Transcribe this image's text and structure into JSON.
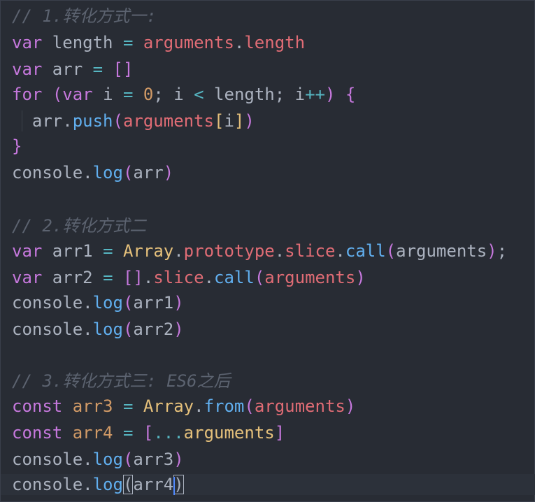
{
  "editor": {
    "language": "javascript",
    "theme_background": "#282c34",
    "lines": [
      [
        {
          "t": "// 1.转化方式一:",
          "k": "comment"
        }
      ],
      [
        {
          "t": "var",
          "k": "keyword"
        },
        {
          "t": " length ",
          "k": "var"
        },
        {
          "t": "=",
          "k": "op"
        },
        {
          "t": " ",
          "k": "var"
        },
        {
          "t": "arguments",
          "k": "prop"
        },
        {
          "t": ".",
          "k": "punct"
        },
        {
          "t": "length",
          "k": "prop"
        }
      ],
      [
        {
          "t": "var",
          "k": "keyword"
        },
        {
          "t": " arr ",
          "k": "var"
        },
        {
          "t": "=",
          "k": "op"
        },
        {
          "t": " ",
          "k": "var"
        },
        {
          "t": "[]",
          "k": "bracket"
        }
      ],
      [
        {
          "t": "for",
          "k": "keyword"
        },
        {
          "t": " ",
          "k": "var"
        },
        {
          "t": "(",
          "k": "bracket"
        },
        {
          "t": "var",
          "k": "keyword"
        },
        {
          "t": " i ",
          "k": "var"
        },
        {
          "t": "=",
          "k": "op"
        },
        {
          "t": " ",
          "k": "var"
        },
        {
          "t": "0",
          "k": "number"
        },
        {
          "t": "; i ",
          "k": "var"
        },
        {
          "t": "<",
          "k": "op"
        },
        {
          "t": " length; i",
          "k": "var"
        },
        {
          "t": "++",
          "k": "op"
        },
        {
          "t": ")",
          "k": "bracket"
        },
        {
          "t": " ",
          "k": "var"
        },
        {
          "t": "{",
          "k": "bracket"
        }
      ],
      [
        {
          "t": "  arr",
          "k": "var"
        },
        {
          "t": ".",
          "k": "punct"
        },
        {
          "t": "push",
          "k": "func"
        },
        {
          "t": "(",
          "k": "bracket"
        },
        {
          "t": "arguments",
          "k": "prop"
        },
        {
          "t": "[",
          "k": "class"
        },
        {
          "t": "i",
          "k": "var"
        },
        {
          "t": "]",
          "k": "class"
        },
        {
          "t": ")",
          "k": "bracket"
        }
      ],
      [
        {
          "t": "}",
          "k": "bracket"
        }
      ],
      [
        {
          "t": "console",
          "k": "var"
        },
        {
          "t": ".",
          "k": "punct"
        },
        {
          "t": "log",
          "k": "func"
        },
        {
          "t": "(",
          "k": "bracket"
        },
        {
          "t": "arr",
          "k": "var"
        },
        {
          "t": ")",
          "k": "bracket"
        }
      ],
      [],
      [
        {
          "t": "// 2.转化方式二",
          "k": "comment"
        }
      ],
      [
        {
          "t": "var",
          "k": "keyword"
        },
        {
          "t": " arr1 ",
          "k": "var"
        },
        {
          "t": "=",
          "k": "op"
        },
        {
          "t": " ",
          "k": "var"
        },
        {
          "t": "Array",
          "k": "class"
        },
        {
          "t": ".",
          "k": "punct"
        },
        {
          "t": "prototype",
          "k": "prop"
        },
        {
          "t": ".",
          "k": "punct"
        },
        {
          "t": "slice",
          "k": "prop"
        },
        {
          "t": ".",
          "k": "punct"
        },
        {
          "t": "call",
          "k": "func"
        },
        {
          "t": "(",
          "k": "bracket"
        },
        {
          "t": "arguments",
          "k": "var"
        },
        {
          "t": ")",
          "k": "bracket"
        },
        {
          "t": ";",
          "k": "punct"
        }
      ],
      [
        {
          "t": "var",
          "k": "keyword"
        },
        {
          "t": " arr2 ",
          "k": "var"
        },
        {
          "t": "=",
          "k": "op"
        },
        {
          "t": " ",
          "k": "var"
        },
        {
          "t": "[]",
          "k": "bracket"
        },
        {
          "t": ".",
          "k": "punct"
        },
        {
          "t": "slice",
          "k": "prop"
        },
        {
          "t": ".",
          "k": "punct"
        },
        {
          "t": "call",
          "k": "func"
        },
        {
          "t": "(",
          "k": "bracket"
        },
        {
          "t": "arguments",
          "k": "prop"
        },
        {
          "t": ")",
          "k": "bracket"
        }
      ],
      [
        {
          "t": "console",
          "k": "var"
        },
        {
          "t": ".",
          "k": "punct"
        },
        {
          "t": "log",
          "k": "func"
        },
        {
          "t": "(",
          "k": "bracket"
        },
        {
          "t": "arr1",
          "k": "var"
        },
        {
          "t": ")",
          "k": "bracket"
        }
      ],
      [
        {
          "t": "console",
          "k": "var"
        },
        {
          "t": ".",
          "k": "punct"
        },
        {
          "t": "log",
          "k": "func"
        },
        {
          "t": "(",
          "k": "bracket"
        },
        {
          "t": "arr2",
          "k": "var"
        },
        {
          "t": ")",
          "k": "bracket"
        }
      ],
      [],
      [
        {
          "t": "// 3.转化方式三: ES6之后",
          "k": "comment"
        }
      ],
      [
        {
          "t": "const",
          "k": "keyword"
        },
        {
          "t": " ",
          "k": "var"
        },
        {
          "t": "arr3",
          "k": "const"
        },
        {
          "t": " ",
          "k": "var"
        },
        {
          "t": "=",
          "k": "op"
        },
        {
          "t": " ",
          "k": "var"
        },
        {
          "t": "Array",
          "k": "class"
        },
        {
          "t": ".",
          "k": "punct"
        },
        {
          "t": "from",
          "k": "func"
        },
        {
          "t": "(",
          "k": "bracket"
        },
        {
          "t": "arguments",
          "k": "prop"
        },
        {
          "t": ")",
          "k": "bracket"
        }
      ],
      [
        {
          "t": "const",
          "k": "keyword"
        },
        {
          "t": " ",
          "k": "var"
        },
        {
          "t": "arr4",
          "k": "const"
        },
        {
          "t": " ",
          "k": "var"
        },
        {
          "t": "=",
          "k": "op"
        },
        {
          "t": " ",
          "k": "var"
        },
        {
          "t": "[",
          "k": "bracket"
        },
        {
          "t": "...",
          "k": "op"
        },
        {
          "t": "arguments",
          "k": "class"
        },
        {
          "t": "]",
          "k": "bracket"
        }
      ],
      [
        {
          "t": "console",
          "k": "var"
        },
        {
          "t": ".",
          "k": "punct"
        },
        {
          "t": "log",
          "k": "func"
        },
        {
          "t": "(",
          "k": "bracket"
        },
        {
          "t": "arr3",
          "k": "var"
        },
        {
          "t": ")",
          "k": "bracket"
        }
      ],
      [
        {
          "t": "console",
          "k": "var"
        },
        {
          "t": ".",
          "k": "punct"
        },
        {
          "t": "log",
          "k": "func"
        },
        {
          "t": "(",
          "k": "bracket-match"
        },
        {
          "t": "arr4",
          "k": "var"
        },
        {
          "t": ")",
          "k": "bracket-match"
        }
      ]
    ],
    "active_line": 18
  }
}
